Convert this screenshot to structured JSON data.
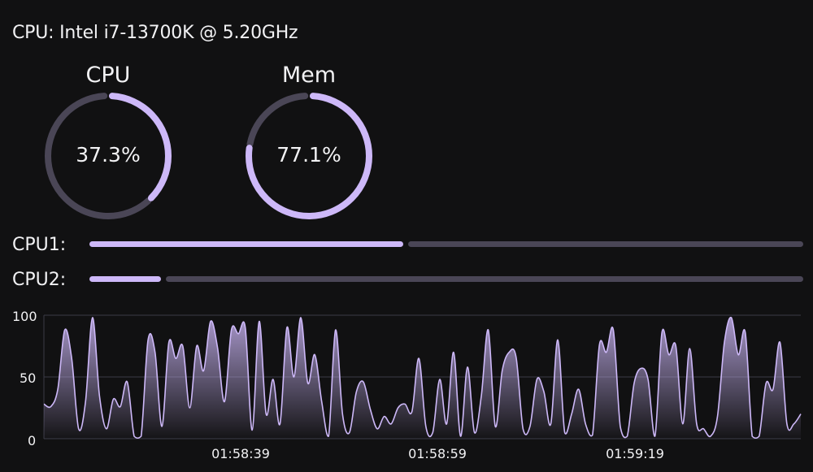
{
  "title": "CPU: Intel i7-13700K @ 5.20GHz",
  "colors": {
    "accent": "#cdb8f8",
    "track": "#4a4656",
    "background": "#111112",
    "grid": "#3a3a46"
  },
  "gauges": [
    {
      "label": "CPU",
      "value": 37.3,
      "display": "37.3%"
    },
    {
      "label": "Mem",
      "value": 77.1,
      "display": "77.1%"
    }
  ],
  "cores": [
    {
      "label": "CPU1:",
      "value": 44
    },
    {
      "label": "CPU2:",
      "value": 10
    }
  ],
  "history": {
    "yticks": [
      "100",
      "50",
      "0"
    ],
    "xticks": [
      "01:58:39",
      "01:58:59",
      "01:59:19"
    ],
    "values": [
      28,
      26,
      40,
      88,
      65,
      8,
      30,
      98,
      35,
      8,
      32,
      26,
      46,
      2,
      2,
      80,
      70,
      10,
      78,
      65,
      75,
      25,
      75,
      55,
      95,
      74,
      30,
      88,
      85,
      90,
      7,
      95,
      20,
      48,
      12,
      90,
      50,
      98,
      45,
      68,
      30,
      2,
      88,
      20,
      5,
      38,
      46,
      24,
      8,
      18,
      12,
      25,
      28,
      22,
      65,
      10,
      5,
      48,
      12,
      70,
      2,
      58,
      5,
      35,
      88,
      10,
      55,
      70,
      66,
      8,
      10,
      48,
      38,
      12,
      80,
      5,
      20,
      40,
      12,
      3,
      76,
      70,
      88,
      10,
      2,
      45,
      57,
      48,
      2,
      86,
      68,
      75,
      12,
      73,
      12,
      8,
      2,
      18,
      78,
      98,
      68,
      86,
      2,
      2,
      45,
      40,
      78,
      12,
      12,
      20
    ]
  }
}
